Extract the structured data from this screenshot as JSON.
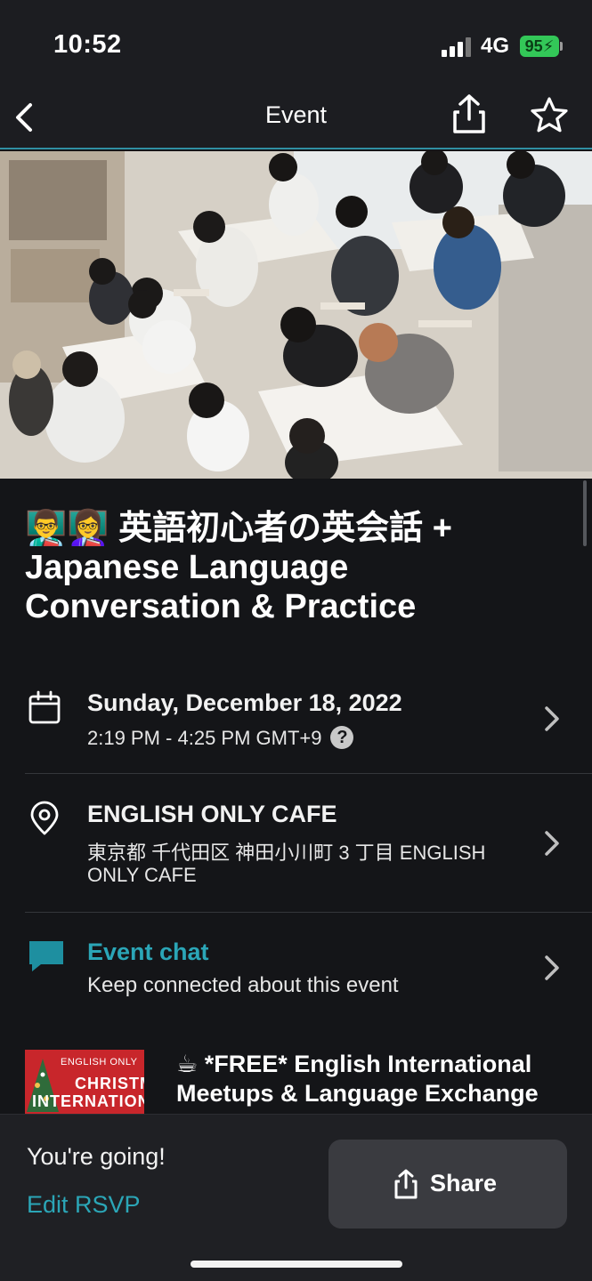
{
  "status_bar": {
    "time": "10:52",
    "network": "4G",
    "battery": "95",
    "icons": [
      "signal-bars-icon",
      "battery-charging-icon"
    ]
  },
  "nav": {
    "title": "Event",
    "icons": [
      "back-chevron-icon",
      "share-icon",
      "star-icon"
    ]
  },
  "hero": {
    "icon": "event-photo"
  },
  "event": {
    "title": "👨‍🏫👩‍🏫 英語初心者の英会話 + Japanese Language Conversation & Practice"
  },
  "date_row": {
    "icon": "calendar-icon",
    "date": "Sunday, December 18, 2022",
    "time": "2:19 PM - 4:25 PM GMT+9",
    "help": "?"
  },
  "location_row": {
    "icon": "location-pin-icon",
    "name": "ENGLISH ONLY CAFE",
    "address": "東京都 千代田区 神田小川町 3 丁目 ENGLISH ONLY CAFE"
  },
  "chat_row": {
    "icon": "chat-bubble-icon",
    "title": "Event chat",
    "subtitle": "Keep connected about this event"
  },
  "related": {
    "thumb_line1": "ENGLISH ONLY",
    "thumb_line2": "CHRISTMAS",
    "thumb_line3": "INTERNATIONAL",
    "title": "☕ *FREE* English International Meetups & Language Exchange"
  },
  "bottom": {
    "status": "You're going!",
    "edit_rsvp": "Edit RSVP",
    "share_label": "Share"
  },
  "colors": {
    "background": "#141518",
    "accent": "#2ba6b7",
    "bar": "#1f2024"
  }
}
